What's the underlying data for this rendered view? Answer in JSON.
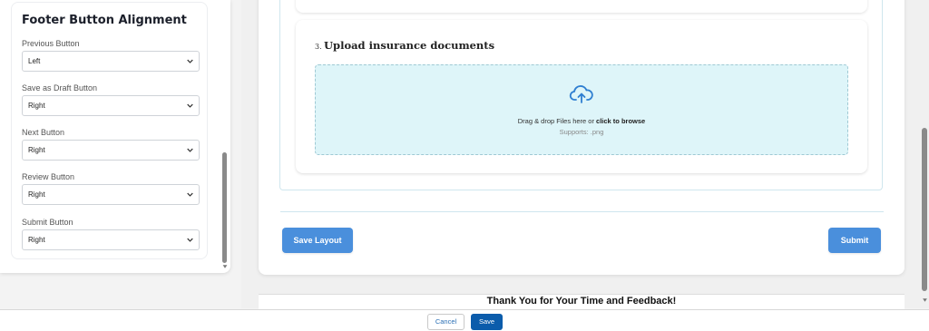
{
  "settings": {
    "title": "Footer Button Alignment",
    "fields": [
      {
        "label": "Previous Button",
        "value": "Left"
      },
      {
        "label": "Save as Draft Button",
        "value": "Right"
      },
      {
        "label": "Next Button",
        "value": "Right"
      },
      {
        "label": "Review Button",
        "value": "Right"
      },
      {
        "label": "Submit Button",
        "value": "Right"
      }
    ]
  },
  "question": {
    "number": "3.",
    "title": "Upload insurance documents",
    "dropzone_text": "Drag & drop Files here or ",
    "dropzone_link": "click to browse",
    "supports": "Supports: .png",
    "icon": "cloud-upload-icon"
  },
  "form_actions": {
    "save_layout": "Save Layout",
    "submit": "Submit"
  },
  "thank_you": "Thank You for Your Time and Feedback!",
  "footer": {
    "cancel": "Cancel",
    "save": "Save"
  },
  "colors": {
    "primary_button": "#4a8fdc",
    "save_button": "#0b5cab",
    "dropzone_bg": "#def5f9",
    "upload_icon": "#2f7fd1"
  }
}
